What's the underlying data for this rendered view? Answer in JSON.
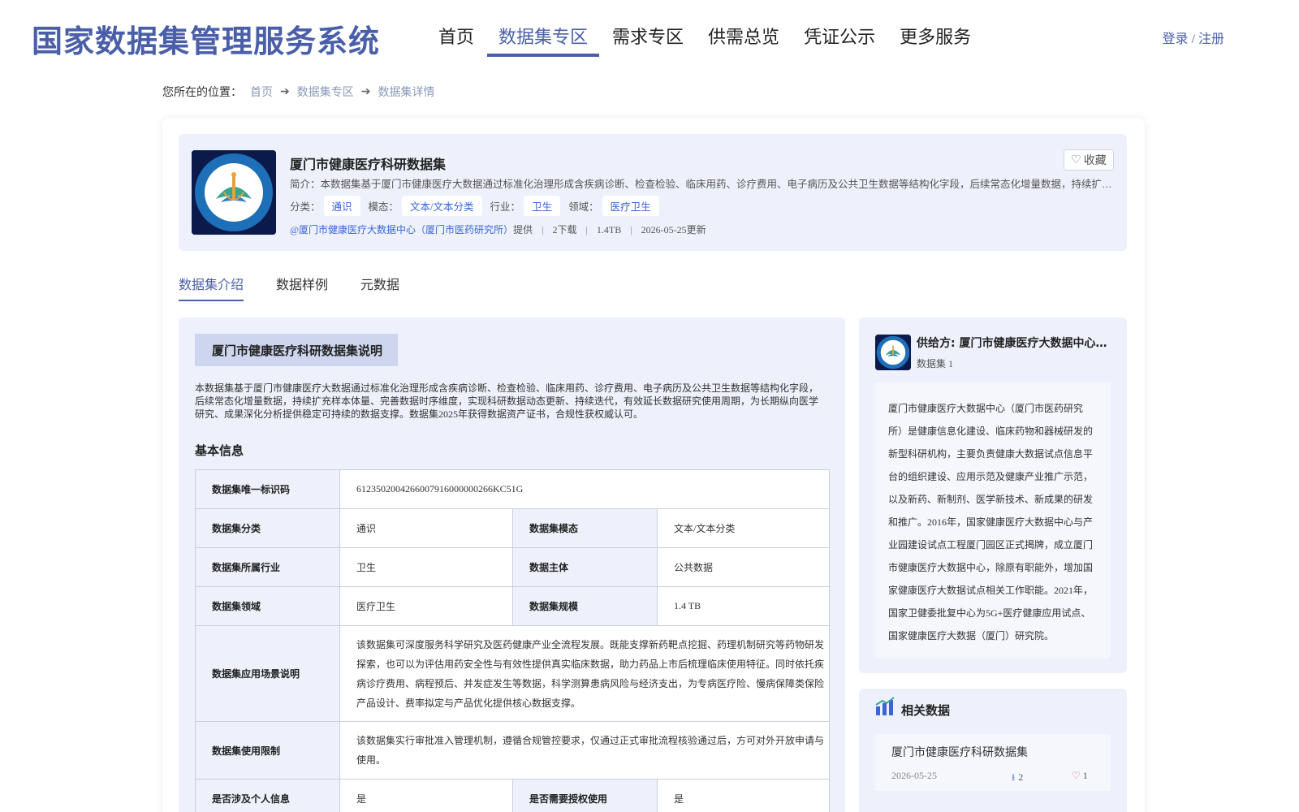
{
  "header": {
    "site_title": "国家数据集管理服务系统",
    "nav": [
      {
        "label": "首页",
        "active": false
      },
      {
        "label": "数据集专区",
        "active": true
      },
      {
        "label": "需求专区",
        "active": false
      },
      {
        "label": "供需总览",
        "active": false
      },
      {
        "label": "凭证公示",
        "active": false
      },
      {
        "label": "更多服务",
        "active": false
      }
    ],
    "login": "登录 / 注册"
  },
  "breadcrumb": {
    "label": "您所在的位置：",
    "items": [
      "首页",
      "数据集专区",
      "数据集详情"
    ]
  },
  "summary": {
    "title": "厦门市健康医疗科研数据集",
    "intro": "简介：本数据集基于厦门市健康医疗大数据通过标准化治理形成含疾病诊断、检查检验、临床用药、诊疗费用、电子病历及公共卫生数据等结构化字段，后续常态化增量数据，持续扩充样本...",
    "favorite": "收藏",
    "tags": {
      "category_key": "分类：",
      "category": "通识",
      "modality_key": "模态：",
      "modality": "文本/文本分类",
      "industry_key": "行业：",
      "industry": "卫生",
      "domain_key": "领域：",
      "domain": "医疗卫生"
    },
    "meta": {
      "provider": "@厦门市健康医疗大数据中心（厦门市医药研究所）",
      "provide": "提供",
      "downloads": "2下载",
      "size": "1.4TB",
      "updated": "2026-05-25更新"
    }
  },
  "tabs": [
    "数据集介绍",
    "数据样例",
    "元数据"
  ],
  "description": {
    "heading": "厦门市健康医疗科研数据集说明",
    "text": "本数据集基于厦门市健康医疗大数据通过标准化治理形成含疾病诊断、检查检验、临床用药、诊疗费用、电子病历及公共卫生数据等结构化字段，后续常态化增量数据，持续扩充样本体量、完善数据时序维度，实现科研数据动态更新、持续迭代，有效延长数据研究使用周期，为长期纵向医学研究、成果深化分析提供稳定可持续的数据支撑。数据集2025年获得数据资产证书，合规性获权威认可。"
  },
  "basic_info": {
    "title": "基本信息",
    "uid_key": "数据集唯一标识码",
    "uid": "6123502004266007916000000266KC51G",
    "rows": [
      {
        "k1": "数据集分类",
        "v1": "通识",
        "k2": "数据集模态",
        "v2": "文本/文本分类"
      },
      {
        "k1": "数据集所属行业",
        "v1": "卫生",
        "k2": "数据主体",
        "v2": "公共数据"
      },
      {
        "k1": "数据集领域",
        "v1": "医疗卫生",
        "k2": "数据集规模",
        "v2": "1.4 TB"
      }
    ],
    "scenario_key": "数据集应用场景说明",
    "scenario": "该数据集可深度服务科学研究及医药健康产业全流程发展。既能支撑新药靶点挖掘、药理机制研究等药物研发探索，也可以为评估用药安全性与有效性提供真实临床数据，助力药品上市后梳理临床使用特征。同时依托疾病诊疗费用、病程预后、并发症发生等数据，科学测算患病风险与经济支出，为专病医疗险、慢病保障类保险产品设计、费率拟定与产品优化提供核心数据支撑。",
    "limit_key": "数据集使用限制",
    "limit": "该数据集实行审批准入管理机制，遵循合规管控要求，仅通过正式审批流程核验通过后，方可对外开放申请与使用。",
    "personal_key": "是否涉及个人信息",
    "personal": "是",
    "auth_key": "是否需要授权使用",
    "auth": "是"
  },
  "provider": {
    "name": "供给方: 厦门市健康医疗大数据中心（厦门市医药研究所）",
    "count": "数据集 1",
    "description": "厦门市健康医疗大数据中心（厦门市医药研究所）是健康信息化建设、临床药物和器械研发的新型科研机构，主要负责健康大数据试点信息平台的组织建设、应用示范及健康产业推广示范，以及新药、新制剂、医学新技术、新成果的研发和推广。2016年，国家健康医疗大数据中心与产业园建设试点工程厦门园区正式揭牌，成立厦门市健康医疗大数据中心，除原有职能外，增加国家健康医疗大数据试点相关工作职能。2021年，国家卫健委批复中心为5G+医疗健康应用试点、国家健康医疗大数据（厦门）研究院。"
  },
  "related": {
    "title": "相关数据",
    "items": [
      {
        "title": "厦门市健康医疗科研数据集",
        "date": "2026-05-25",
        "downloads": "2",
        "likes": "1"
      }
    ]
  },
  "colors": {
    "accent": "#4a5fa8",
    "link": "#3a64d8",
    "panel": "#eef1fb"
  },
  "icons": [
    "heart-icon",
    "arrow-right-icon",
    "download-icon",
    "bar-chart-icon"
  ]
}
